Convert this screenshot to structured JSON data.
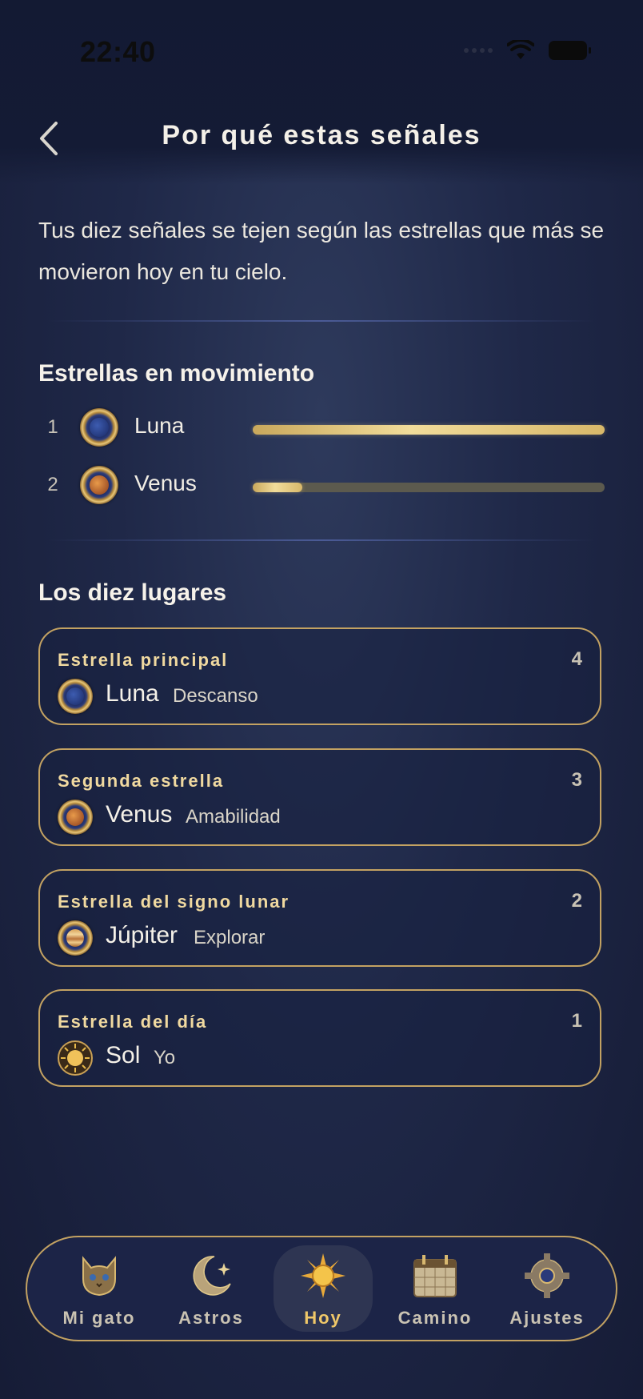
{
  "status_bar": {
    "time": "22:40"
  },
  "header": {
    "title": "Por qué estas señales"
  },
  "intro_text": "Tus diez señales se tejen según las estrellas que más se movieron hoy en tu cielo.",
  "movement": {
    "title": "Estrellas en movimiento",
    "items": [
      {
        "rank": "1",
        "name": "Luna",
        "icon": "moon-planet-icon",
        "level": 1.0
      },
      {
        "rank": "2",
        "name": "Venus",
        "icon": "venus-planet-icon",
        "level": 0.14
      }
    ]
  },
  "places": {
    "title": "Los diez lugares",
    "cards": [
      {
        "label": "Estrella principal",
        "count": "4",
        "planet": "Luna",
        "word": "Descanso",
        "icon": "moon-planet-icon"
      },
      {
        "label": "Segunda estrella",
        "count": "3",
        "planet": "Venus",
        "word": "Amabilidad",
        "icon": "venus-planet-icon"
      },
      {
        "label": "Estrella del signo lunar",
        "count": "2",
        "planet": "Júpiter",
        "word": "Explorar",
        "icon": "jupiter-planet-icon"
      },
      {
        "label": "Estrella del día",
        "count": "1",
        "planet": "Sol",
        "word": "Yo",
        "icon": "sun-planet-icon"
      }
    ]
  },
  "tabbar": {
    "active": "Hoy",
    "items": [
      {
        "label": "Mi gato",
        "icon": "cat-icon"
      },
      {
        "label": "Astros",
        "icon": "crescent-moon-icon"
      },
      {
        "label": "Hoy",
        "icon": "sun-icon"
      },
      {
        "label": "Camino",
        "icon": "calendar-icon"
      },
      {
        "label": "Ajustes",
        "icon": "gear-icon"
      }
    ]
  },
  "colors": {
    "accent_gold": "#c3a262",
    "active_tab": "#f0c869",
    "background": "#1f2848"
  }
}
